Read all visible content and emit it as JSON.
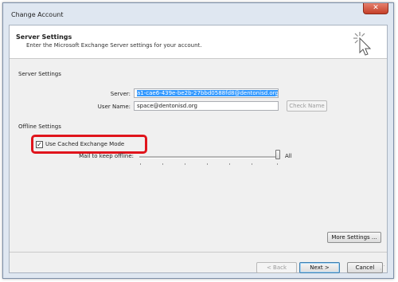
{
  "window": {
    "title": "Change Account",
    "close_label": "✕"
  },
  "header": {
    "title": "Server Settings",
    "subtitle": "Enter the Microsoft Exchange Server settings for your account."
  },
  "server_settings": {
    "section_title": "Server Settings",
    "server_label": "Server:",
    "server_value": "a1-cae6-439e-be2b-27bbd0588fd8@dentonisd.org",
    "username_label": "User Name:",
    "username_value": "space@dentonisd.org",
    "check_name_label": "Check Name"
  },
  "offline_settings": {
    "section_title": "Offline Settings",
    "cached_mode_label": "Use Cached Exchange Mode",
    "cached_mode_checked": true,
    "mail_offline_label": "Mail to keep offline:",
    "mail_offline_value": "All"
  },
  "buttons": {
    "more_settings": "More Settings ...",
    "back": "< Back",
    "next": "Next >",
    "cancel": "Cancel"
  },
  "colors": {
    "highlight": "#e0141c",
    "selection": "#3399ff"
  }
}
